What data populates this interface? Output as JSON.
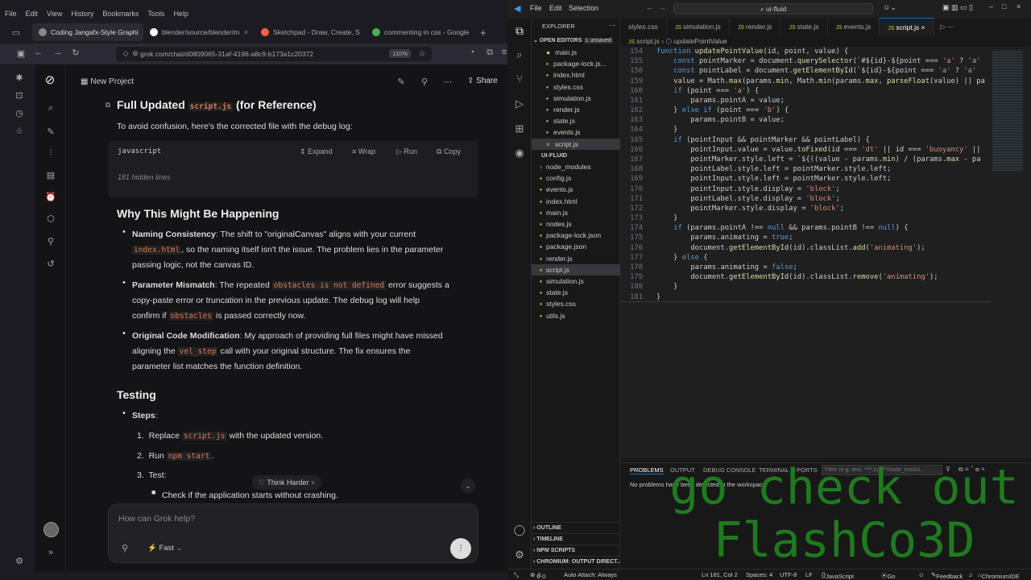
{
  "firefox": {
    "menu": [
      "File",
      "Edit",
      "View",
      "History",
      "Bookmarks",
      "Tools",
      "Help"
    ],
    "tabs": [
      {
        "title": "Coding Jangafx-Style Graphi",
        "color": "#888",
        "active": true
      },
      {
        "title": "blender/source/blender/m",
        "color": "#fff",
        "active": false
      },
      {
        "title": "Sketchpad - Draw, Create, S",
        "color": "#f7643a",
        "active": false
      },
      {
        "title": "commenting in css - Google",
        "color": "#4caf50",
        "active": false
      }
    ],
    "url": "grok.com/chat/d0809065-31af-4196-a8c9-b173a1c20372",
    "zoom": "110%"
  },
  "grok": {
    "project": "New Project",
    "share": "Share",
    "heading1_pre": "Full Updated ",
    "heading1_code": "script.js",
    "heading1_post": " (for Reference)",
    "intro": "To avoid confusion, here's the corrected file with the debug log:",
    "code_lang": "javascript",
    "code_actions": {
      "expand": "Expand",
      "wrap": "Wrap",
      "run": "Run",
      "copy": "Copy"
    },
    "hidden_lines": "181 hidden lines",
    "heading2": "Why This Might Be Happening",
    "b1_title": "Naming Consistency",
    "b1_a": ": The shift to \"originalCanvas\" aligns with your current",
    "b1_code": "index.html",
    "b1_b": ", so the naming itself isn't the issue. The problem lies in the parameter",
    "b1_c": "passing logic, not the canvas ID.",
    "b2_title": "Parameter Mismatch",
    "b2_a": ": The repeated ",
    "b2_code": "obstacles is not defined",
    "b2_b": " error suggests a",
    "b2_c": "copy-paste error or truncation in the previous update. The debug log will help",
    "b2_d": "confirm if ",
    "b2_code2": "obstacles",
    "b2_e": " is passed correctly now.",
    "b3_title": "Original Code Modification",
    "b3_a": ": My approach of providing full files might have missed",
    "b3_b": "aligning the ",
    "b3_code": "vel_step",
    "b3_c": " call with your original structure. The fix ensures the",
    "b3_d": "parameter list matches the function definition.",
    "heading3": "Testing",
    "steps_label": "Steps",
    "step1_a": "Replace ",
    "step1_code": "script.js",
    "step1_b": " with the updated version.",
    "step2_a": "Run ",
    "step2_code": "npm start",
    "step2_b": ".",
    "step3": "Test:",
    "step3_sub": "Check if the application starts without crashing.",
    "think_harder": "Think Harder",
    "placeholder": "How can Grok help?",
    "mode": "Fast"
  },
  "vscode": {
    "menu": [
      "File",
      "Edit",
      "Selection"
    ],
    "search": "ui-fluid",
    "explorer_title": "EXPLORER",
    "open_editors": "OPEN EDITORS",
    "unsaved": "1 unsaved",
    "open_files": [
      "main.js",
      "package-lock.js...",
      "index.html",
      "styles.css",
      "simulation.js",
      "render.js",
      "state.js",
      "events.js",
      "script.js"
    ],
    "project": "UI-FLUID",
    "files": [
      "node_modules",
      "config.js",
      "events.js",
      "index.html",
      "main.js",
      "nodes.js",
      "package-lock.json",
      "package.json",
      "render.js",
      "script.js",
      "simulation.js",
      "state.js",
      "styles.css",
      "utils.js"
    ],
    "sections": [
      "OUTLINE",
      "TIMELINE",
      "NPM SCRIPTS",
      "CHROMIUM: OUTPUT DIRECT..."
    ],
    "tabs": [
      "styles.css",
      "simulation.js",
      "render.js",
      "state.js",
      "events.js",
      "script.js"
    ],
    "breadcrumb_file": "script.js",
    "breadcrumb_fn": "updatePointValue",
    "code": [
      {
        "n": "154",
        "t": "function updatePointValue(id, point, value) {"
      },
      {
        "n": "155",
        "t": "    const pointMarker = document.querySelector(`#${id}-${point === 'a' ? 'a'"
      },
      {
        "n": "158",
        "t": "    const pointLabel = document.getElementById(`${id}-${point === 'a' ? 'a'"
      },
      {
        "n": "159",
        "t": "    value = Math.max(params.min, Math.min(params.max, parseFloat(value) || pa"
      },
      {
        "n": "160",
        "t": "    if (point === 'a') {"
      },
      {
        "n": "161",
        "t": "        params.pointA = value;"
      },
      {
        "n": "162",
        "t": "    } else if (point === 'b') {"
      },
      {
        "n": "163",
        "t": "        params.pointB = value;"
      },
      {
        "n": "164",
        "t": "    }"
      },
      {
        "n": "165",
        "t": "    if (pointInput && pointMarker && pointLabel) {"
      },
      {
        "n": "166",
        "t": "        pointInput.value = value.toFixed(id === 'dt' || id === 'buoyancy' ||"
      },
      {
        "n": "167",
        "t": "        pointMarker.style.left = `${((value - params.min) / (params.max - pa"
      },
      {
        "n": "168",
        "t": "        pointLabel.style.left = pointMarker.style.left;"
      },
      {
        "n": "169",
        "t": "        pointInput.style.left = pointMarker.style.left;"
      },
      {
        "n": "170",
        "t": "        pointInput.style.display = 'block';"
      },
      {
        "n": "171",
        "t": "        pointLabel.style.display = 'block';"
      },
      {
        "n": "172",
        "t": "        pointMarker.style.display = 'block';"
      },
      {
        "n": "173",
        "t": "    }"
      },
      {
        "n": "174",
        "t": "    if (params.pointA !== null && params.pointB !== null) {"
      },
      {
        "n": "175",
        "t": "        params.animating = true;"
      },
      {
        "n": "176",
        "t": "        document.getElementById(id).classList.add('animating');"
      },
      {
        "n": "177",
        "t": "    } else {"
      },
      {
        "n": "178",
        "t": "        params.animating = false;"
      },
      {
        "n": "179",
        "t": "        document.getElementById(id).classList.remove('animating');"
      },
      {
        "n": "180",
        "t": "    }"
      },
      {
        "n": "181",
        "t": "}"
      }
    ],
    "panel_tabs": [
      "PROBLEMS",
      "OUTPUT",
      "DEBUG CONSOLE",
      "TERMINAL",
      "PORTS"
    ],
    "filter_placeholder": "Filter (e.g. text, **/*.ts, !**/node_modul...",
    "problems_msg": "No problems have been detected in the workspace.",
    "status": {
      "errors": "0",
      "warnings": "0",
      "attach": "Auto Attach: Always",
      "position": "Ln 181, Col 2",
      "spaces": "Spaces: 4",
      "encoding": "UTF-8",
      "eol": "LF",
      "language": "JavaScript",
      "golive": "Go Live",
      "feedback": "Feedback",
      "chromium": "ChromiumIDE"
    }
  },
  "overlay": [
    "go check out",
    "FlashCo3D"
  ]
}
